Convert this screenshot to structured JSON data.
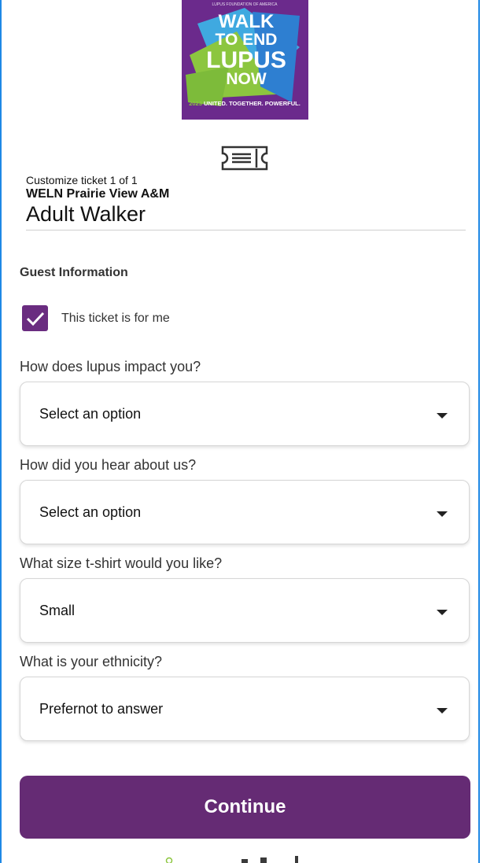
{
  "logo": {
    "org_text": "LUPUS FOUNDATION OF AMERICA",
    "line1": "WALK",
    "line2": "TO END",
    "line3": "LUPUS",
    "line4": "NOW",
    "tagline_year": "2023",
    "tagline": "UNITED. TOGETHER. POWERFUL."
  },
  "ticket": {
    "counter": "Customize ticket 1 of 1",
    "event": "WELN Prairie View A&M",
    "type": "Adult Walker"
  },
  "guest": {
    "section_title": "Guest Information",
    "self_checkbox_label": "This ticket is for me",
    "self_checked": true
  },
  "questions": [
    {
      "label": "How does lupus impact you?",
      "value": "Select an option"
    },
    {
      "label": "How did you hear about us?",
      "value": "Select an option"
    },
    {
      "label": "What size t-shirt would you like?",
      "value": "Small"
    },
    {
      "label": "What is your ethnicity?",
      "value": "Prefernot to answer"
    }
  ],
  "actions": {
    "continue_label": "Continue"
  },
  "colors": {
    "primary": "#652b74",
    "checkbox": "#6a2c80",
    "frame": "#1e88e5"
  }
}
